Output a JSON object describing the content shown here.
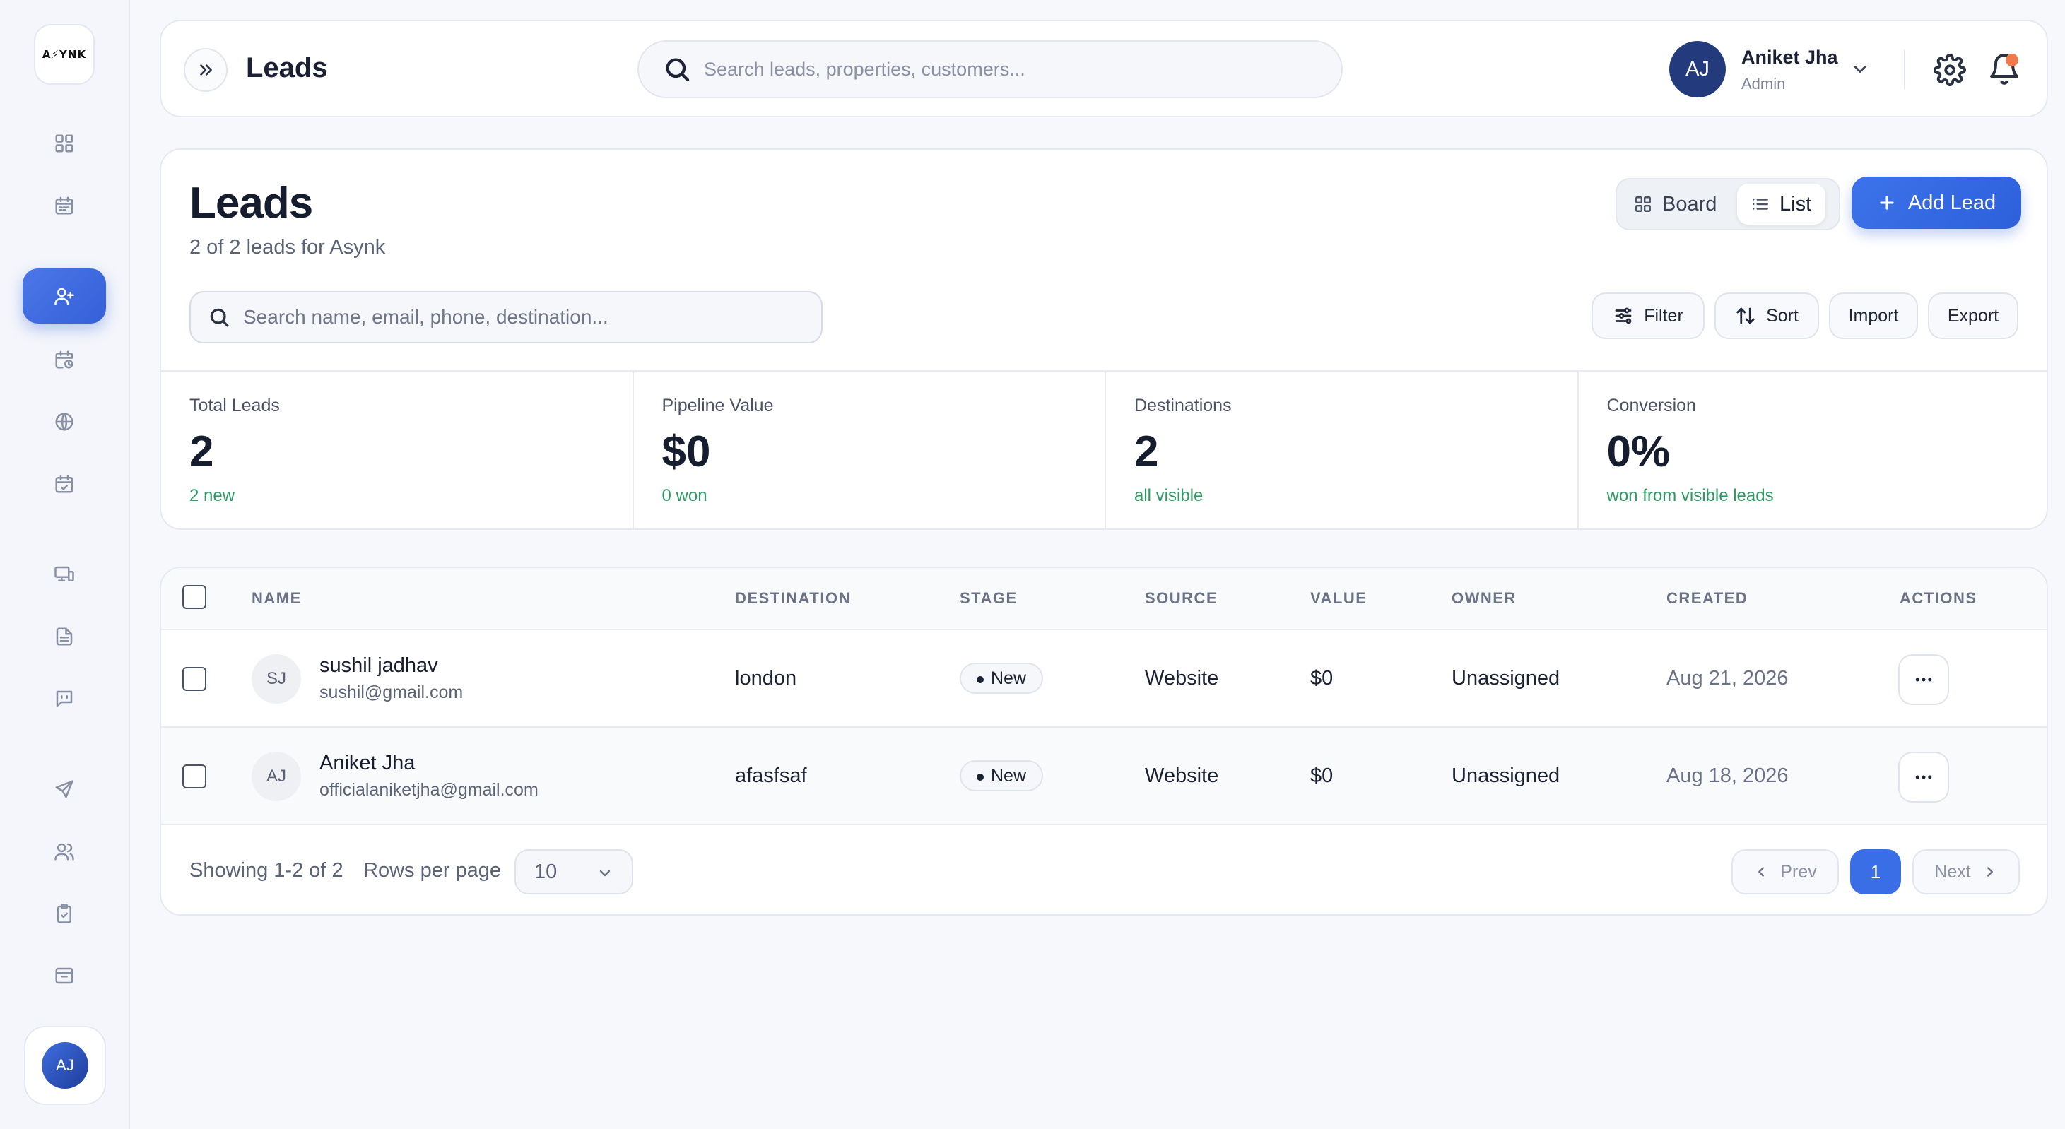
{
  "app": {
    "logo_text": "A⚡YNK"
  },
  "sidebar": {
    "items": [
      {
        "name": "dashboard",
        "icon": "grid-icon"
      },
      {
        "name": "calendar",
        "icon": "calendar-icon"
      },
      {
        "name": "leads",
        "icon": "user-plus-icon",
        "active": true
      },
      {
        "name": "bookings",
        "icon": "calendar-clock-icon"
      },
      {
        "name": "destinations",
        "icon": "globe-icon"
      },
      {
        "name": "schedule",
        "icon": "calendar-check-icon"
      },
      {
        "name": "devices",
        "icon": "monitor-icon"
      },
      {
        "name": "documents",
        "icon": "file-icon"
      },
      {
        "name": "messages",
        "icon": "chat-icon"
      },
      {
        "name": "trips",
        "icon": "plane-icon"
      },
      {
        "name": "team",
        "icon": "users-icon"
      },
      {
        "name": "tasks",
        "icon": "clipboard-icon"
      },
      {
        "name": "inbox",
        "icon": "inbox-icon"
      }
    ],
    "user_initials": "AJ"
  },
  "header": {
    "title": "Leads",
    "search_placeholder": "Search leads, properties, customers...",
    "user": {
      "initials": "AJ",
      "name": "Aniket Jha",
      "role": "Admin"
    },
    "notification_dot_color": "#f07a4c"
  },
  "main": {
    "title": "Leads",
    "subtitle": "2 of 2 leads for Asynk",
    "view_toggle": {
      "board_label": "Board",
      "list_label": "List",
      "active": "List"
    },
    "add_button_label": "Add Lead",
    "search_placeholder": "Search name, email, phone, destination...",
    "tools": {
      "filter": "Filter",
      "sort": "Sort",
      "import": "Import",
      "export": "Export"
    },
    "stats": [
      {
        "label": "Total Leads",
        "value": "2",
        "note": "2 new"
      },
      {
        "label": "Pipeline Value",
        "value": "$0",
        "note": "0 won"
      },
      {
        "label": "Destinations",
        "value": "2",
        "note": "all visible"
      },
      {
        "label": "Conversion",
        "value": "0%",
        "note": "won from visible leads"
      }
    ]
  },
  "table": {
    "columns": {
      "name": "NAME",
      "destination": "DESTINATION",
      "stage": "STAGE",
      "source": "SOURCE",
      "value": "VALUE",
      "owner": "OWNER",
      "created": "CREATED",
      "actions": "ACTIONS"
    },
    "rows": [
      {
        "initials": "SJ",
        "name": "sushil jadhav",
        "email": "sushil@gmail.com",
        "destination": "london",
        "stage": "New",
        "source": "Website",
        "value": "$0",
        "owner": "Unassigned",
        "created": "Aug 21, 2026"
      },
      {
        "initials": "AJ",
        "name": "Aniket Jha",
        "email": "officialaniketjha@gmail.com",
        "destination": "afasfsaf",
        "stage": "New",
        "source": "Website",
        "value": "$0",
        "owner": "Unassigned",
        "created": "Aug 18, 2026"
      }
    ],
    "footer": {
      "showing": "Showing 1-2 of 2",
      "rows_per_page_label": "Rows per page",
      "rows_per_page_value": "10",
      "prev_label": "Prev",
      "next_label": "Next",
      "current_page": "1"
    }
  },
  "colors": {
    "accent": "#3a6ee6",
    "positive_note": "#2f9a63"
  }
}
